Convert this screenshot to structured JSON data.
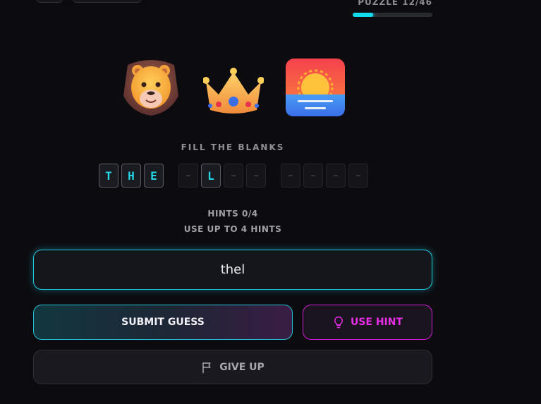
{
  "header": {
    "puzzle_counter": "PUZZLE 12/46",
    "progress_fraction": 0.26
  },
  "clues": [
    {
      "icon": "lion-face-icon"
    },
    {
      "icon": "crown-icon"
    },
    {
      "icon": "sunset-icon"
    }
  ],
  "fill_label": "FILL THE BLANKS",
  "blank_tiles": [
    "T",
    "H",
    "E",
    "–",
    "L",
    "–",
    "–",
    "–",
    "–",
    "–",
    "–"
  ],
  "hints": {
    "count_text": "HINTS 0/4",
    "subtext": "USE UP TO 4 HINTS"
  },
  "guess_input": {
    "value": "thel"
  },
  "buttons": {
    "submit_label": "SUBMIT GUESS",
    "hint_label": "USE HINT",
    "give_up_label": "GIVE UP"
  },
  "colors": {
    "accent_cyan": "#14dcf0",
    "accent_magenta": "#ea2eea",
    "background": "#0c0c10"
  }
}
